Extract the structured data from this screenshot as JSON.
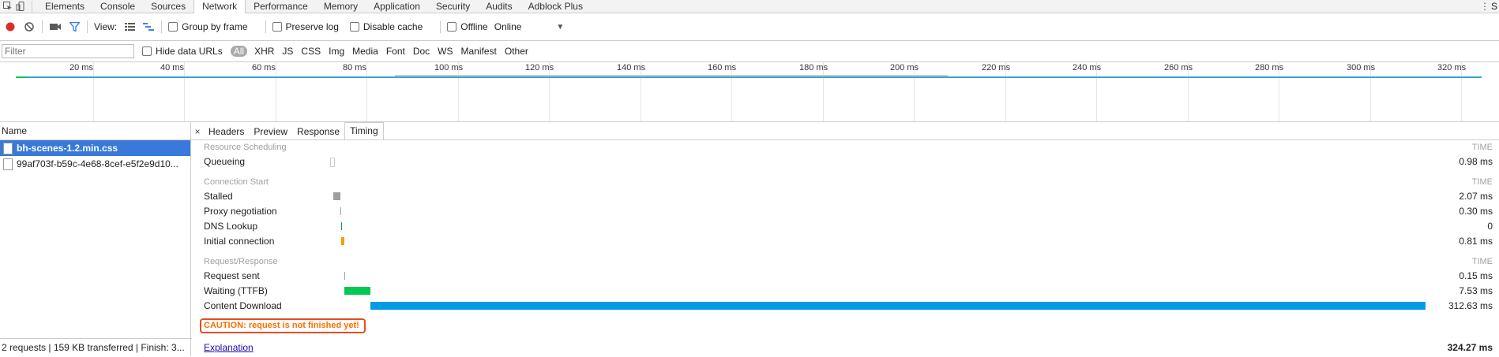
{
  "devtools": {
    "tabs": [
      "Elements",
      "Console",
      "Sources",
      "Network",
      "Performance",
      "Memory",
      "Application",
      "Security",
      "Audits",
      "Adblock Plus"
    ],
    "active_tab": "Network",
    "overflow": "S"
  },
  "toolbar": {
    "view_label": "View:",
    "group_by_frame": "Group by frame",
    "preserve_log": "Preserve log",
    "disable_cache": "Disable cache",
    "offline": "Offline",
    "throttle": "Online",
    "record_color": "#d93025"
  },
  "filterbar": {
    "placeholder": "Filter",
    "hide_data_urls": "Hide data URLs",
    "types": [
      "All",
      "XHR",
      "JS",
      "CSS",
      "Img",
      "Media",
      "Font",
      "Doc",
      "WS",
      "Manifest",
      "Other"
    ],
    "selected_type": "All"
  },
  "overview": {
    "ticks": [
      "20 ms",
      "40 ms",
      "60 ms",
      "80 ms",
      "100 ms",
      "120 ms",
      "140 ms",
      "160 ms",
      "180 ms",
      "200 ms",
      "220 ms",
      "240 ms",
      "260 ms",
      "280 ms",
      "300 ms",
      "320 ms"
    ],
    "line_color": "#3aa1d6"
  },
  "grid": {
    "header": "Name",
    "requests": [
      "bh-scenes-1.2.min.css",
      "99af703f-b59c-4e68-8cef-e5f2e9d10..."
    ],
    "status": "2 requests  |  159 KB transferred  |  Finish: 3..."
  },
  "detail": {
    "tabs": [
      "Headers",
      "Preview",
      "Response",
      "Timing"
    ],
    "active_tab": "Timing",
    "sections": [
      {
        "title": "Resource Scheduling",
        "time_header": "TIME",
        "rows": [
          {
            "label": "Queueing",
            "value": "0.98 ms",
            "start_ms": 0,
            "duration_ms": 0.98,
            "color": "#ffffff"
          }
        ]
      },
      {
        "title": "Connection Start",
        "time_header": "TIME",
        "rows": [
          {
            "label": "Stalled",
            "value": "2.07 ms",
            "start_ms": 0.98,
            "duration_ms": 2.07,
            "color": "#9e9e9e"
          },
          {
            "label": "Proxy negotiation",
            "value": "0.30 ms",
            "start_ms": 3.05,
            "duration_ms": 0.3,
            "color": "#9e9e9e"
          },
          {
            "label": "DNS Lookup",
            "value": "0",
            "start_ms": 3.35,
            "duration_ms": 0,
            "color": "#009688"
          },
          {
            "label": "Initial connection",
            "value": "0.81 ms",
            "start_ms": 3.35,
            "duration_ms": 0.81,
            "color": "#ff9800"
          }
        ]
      },
      {
        "title": "Request/Response",
        "time_header": "TIME",
        "rows": [
          {
            "label": "Request sent",
            "value": "0.15 ms",
            "start_ms": 4.16,
            "duration_ms": 0.15,
            "color": "#9e9e9e"
          },
          {
            "label": "Waiting (TTFB)",
            "value": "7.53 ms",
            "start_ms": 4.31,
            "duration_ms": 7.53,
            "color": "#00c853"
          },
          {
            "label": "Content Download",
            "value": "312.63 ms",
            "start_ms": 11.84,
            "duration_ms": 312.63,
            "color": "#039be5"
          }
        ]
      }
    ],
    "caution": "CAUTION: request is not finished yet!",
    "explanation": "Explanation",
    "total": "324.27 ms",
    "total_ms": 324.27
  }
}
